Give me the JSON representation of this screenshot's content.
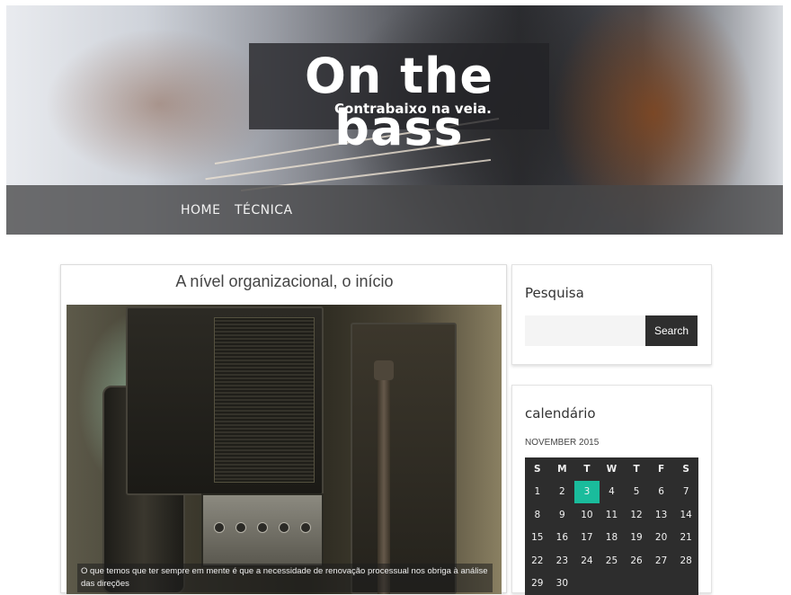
{
  "header": {
    "site_title": "On the bass",
    "site_subtitle": "Contrabaixo na veia.",
    "nav": [
      {
        "label": "HOME"
      },
      {
        "label": "TÉCNICA"
      }
    ]
  },
  "post": {
    "title": "A nível organizacional, o início",
    "caption": "O que temos que ter sempre em mente é que a necessidade de renovação processual nos obriga à análise das direções"
  },
  "sidebar": {
    "search": {
      "title": "Pesquisa",
      "placeholder": "",
      "button_label": "Search"
    },
    "calendar": {
      "title": "calendário",
      "caption": "NOVEMBER 2015",
      "weekdays": [
        "S",
        "M",
        "T",
        "W",
        "T",
        "F",
        "S"
      ],
      "weeks": [
        [
          "1",
          "2",
          "3",
          "4",
          "5",
          "6",
          "7"
        ],
        [
          "8",
          "9",
          "10",
          "11",
          "12",
          "13",
          "14"
        ],
        [
          "15",
          "16",
          "17",
          "18",
          "19",
          "20",
          "21"
        ],
        [
          "22",
          "23",
          "24",
          "25",
          "26",
          "27",
          "28"
        ],
        [
          "29",
          "30",
          "",
          "",
          "",
          "",
          ""
        ]
      ],
      "today": "3"
    }
  },
  "colors": {
    "accent_today": "#1abc9c",
    "calendar_bg": "#2d2d2d",
    "button_bg": "#2e2e2e"
  }
}
